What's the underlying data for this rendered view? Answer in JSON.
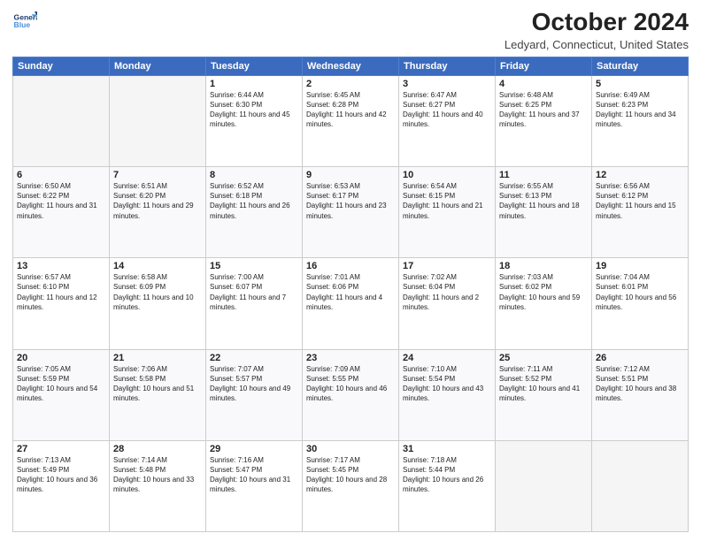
{
  "header": {
    "logo_line1": "General",
    "logo_line2": "Blue",
    "month_title": "October 2024",
    "location": "Ledyard, Connecticut, United States"
  },
  "weekdays": [
    "Sunday",
    "Monday",
    "Tuesday",
    "Wednesday",
    "Thursday",
    "Friday",
    "Saturday"
  ],
  "weeks": [
    [
      {
        "day": "",
        "info": ""
      },
      {
        "day": "",
        "info": ""
      },
      {
        "day": "1",
        "info": "Sunrise: 6:44 AM\nSunset: 6:30 PM\nDaylight: 11 hours and 45 minutes."
      },
      {
        "day": "2",
        "info": "Sunrise: 6:45 AM\nSunset: 6:28 PM\nDaylight: 11 hours and 42 minutes."
      },
      {
        "day": "3",
        "info": "Sunrise: 6:47 AM\nSunset: 6:27 PM\nDaylight: 11 hours and 40 minutes."
      },
      {
        "day": "4",
        "info": "Sunrise: 6:48 AM\nSunset: 6:25 PM\nDaylight: 11 hours and 37 minutes."
      },
      {
        "day": "5",
        "info": "Sunrise: 6:49 AM\nSunset: 6:23 PM\nDaylight: 11 hours and 34 minutes."
      }
    ],
    [
      {
        "day": "6",
        "info": "Sunrise: 6:50 AM\nSunset: 6:22 PM\nDaylight: 11 hours and 31 minutes."
      },
      {
        "day": "7",
        "info": "Sunrise: 6:51 AM\nSunset: 6:20 PM\nDaylight: 11 hours and 29 minutes."
      },
      {
        "day": "8",
        "info": "Sunrise: 6:52 AM\nSunset: 6:18 PM\nDaylight: 11 hours and 26 minutes."
      },
      {
        "day": "9",
        "info": "Sunrise: 6:53 AM\nSunset: 6:17 PM\nDaylight: 11 hours and 23 minutes."
      },
      {
        "day": "10",
        "info": "Sunrise: 6:54 AM\nSunset: 6:15 PM\nDaylight: 11 hours and 21 minutes."
      },
      {
        "day": "11",
        "info": "Sunrise: 6:55 AM\nSunset: 6:13 PM\nDaylight: 11 hours and 18 minutes."
      },
      {
        "day": "12",
        "info": "Sunrise: 6:56 AM\nSunset: 6:12 PM\nDaylight: 11 hours and 15 minutes."
      }
    ],
    [
      {
        "day": "13",
        "info": "Sunrise: 6:57 AM\nSunset: 6:10 PM\nDaylight: 11 hours and 12 minutes."
      },
      {
        "day": "14",
        "info": "Sunrise: 6:58 AM\nSunset: 6:09 PM\nDaylight: 11 hours and 10 minutes."
      },
      {
        "day": "15",
        "info": "Sunrise: 7:00 AM\nSunset: 6:07 PM\nDaylight: 11 hours and 7 minutes."
      },
      {
        "day": "16",
        "info": "Sunrise: 7:01 AM\nSunset: 6:06 PM\nDaylight: 11 hours and 4 minutes."
      },
      {
        "day": "17",
        "info": "Sunrise: 7:02 AM\nSunset: 6:04 PM\nDaylight: 11 hours and 2 minutes."
      },
      {
        "day": "18",
        "info": "Sunrise: 7:03 AM\nSunset: 6:02 PM\nDaylight: 10 hours and 59 minutes."
      },
      {
        "day": "19",
        "info": "Sunrise: 7:04 AM\nSunset: 6:01 PM\nDaylight: 10 hours and 56 minutes."
      }
    ],
    [
      {
        "day": "20",
        "info": "Sunrise: 7:05 AM\nSunset: 5:59 PM\nDaylight: 10 hours and 54 minutes."
      },
      {
        "day": "21",
        "info": "Sunrise: 7:06 AM\nSunset: 5:58 PM\nDaylight: 10 hours and 51 minutes."
      },
      {
        "day": "22",
        "info": "Sunrise: 7:07 AM\nSunset: 5:57 PM\nDaylight: 10 hours and 49 minutes."
      },
      {
        "day": "23",
        "info": "Sunrise: 7:09 AM\nSunset: 5:55 PM\nDaylight: 10 hours and 46 minutes."
      },
      {
        "day": "24",
        "info": "Sunrise: 7:10 AM\nSunset: 5:54 PM\nDaylight: 10 hours and 43 minutes."
      },
      {
        "day": "25",
        "info": "Sunrise: 7:11 AM\nSunset: 5:52 PM\nDaylight: 10 hours and 41 minutes."
      },
      {
        "day": "26",
        "info": "Sunrise: 7:12 AM\nSunset: 5:51 PM\nDaylight: 10 hours and 38 minutes."
      }
    ],
    [
      {
        "day": "27",
        "info": "Sunrise: 7:13 AM\nSunset: 5:49 PM\nDaylight: 10 hours and 36 minutes."
      },
      {
        "day": "28",
        "info": "Sunrise: 7:14 AM\nSunset: 5:48 PM\nDaylight: 10 hours and 33 minutes."
      },
      {
        "day": "29",
        "info": "Sunrise: 7:16 AM\nSunset: 5:47 PM\nDaylight: 10 hours and 31 minutes."
      },
      {
        "day": "30",
        "info": "Sunrise: 7:17 AM\nSunset: 5:45 PM\nDaylight: 10 hours and 28 minutes."
      },
      {
        "day": "31",
        "info": "Sunrise: 7:18 AM\nSunset: 5:44 PM\nDaylight: 10 hours and 26 minutes."
      },
      {
        "day": "",
        "info": ""
      },
      {
        "day": "",
        "info": ""
      }
    ]
  ]
}
